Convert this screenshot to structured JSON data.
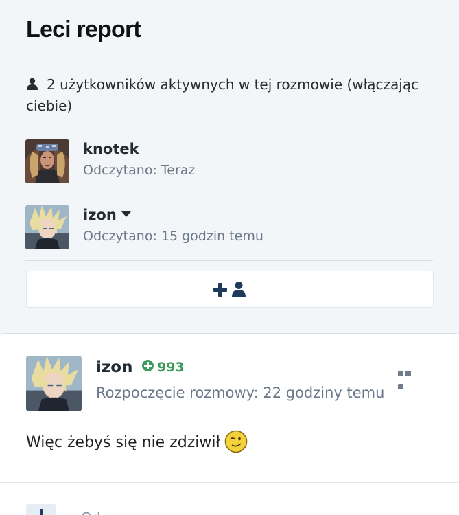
{
  "page": {
    "title": "Leci report"
  },
  "participants": {
    "summary": "2 użytkowników aktywnych w tej rozmowie (włączając ciebie)",
    "members": [
      {
        "name": "knotek",
        "read_status": "Odczytano: Teraz"
      },
      {
        "name": "izon",
        "read_status": "Odczytano: 15 godzin temu"
      }
    ],
    "add_button_icons": [
      "plus-icon",
      "user-icon"
    ]
  },
  "message": {
    "author": "izon",
    "reputation": "993",
    "started": "Rozpoczęcie rozmowy: 22 godziny temu",
    "body": "Więc żebyś się nie zdziwił",
    "emoji": "wink-emoji",
    "accent_color": "#3d9a5a"
  },
  "reply_bar": {
    "placeholder": "Od..."
  }
}
